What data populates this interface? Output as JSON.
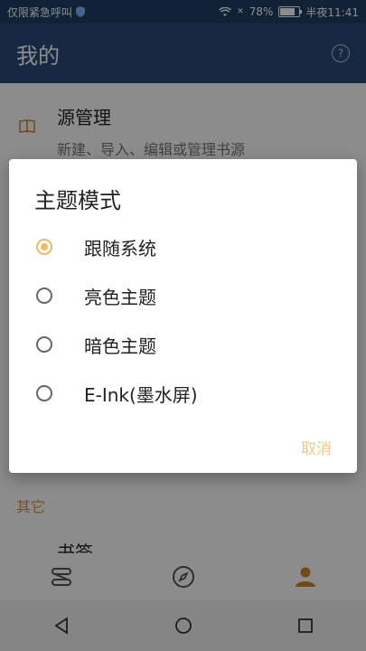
{
  "status_bar": {
    "carrier": "仅限紧急呼叫",
    "battery": "78%",
    "time": "半夜11:41"
  },
  "app_bar": {
    "title": "我的",
    "help_icon": "question-circle-icon"
  },
  "content": {
    "source_item": {
      "title": "源管理",
      "subtitle": "新建、导入、编辑或管理书源",
      "icon": "book-icon"
    },
    "section_other": "其它",
    "bookmark": "书签"
  },
  "dialog": {
    "title": "主题模式",
    "options": [
      {
        "label": "跟随系统",
        "selected": true
      },
      {
        "label": "亮色主题",
        "selected": false
      },
      {
        "label": "暗色主题",
        "selected": false
      },
      {
        "label": "E-Ink(墨水屏)",
        "selected": false
      }
    ],
    "cancel": "取消"
  },
  "bottom_nav": [
    "bookshelf-icon",
    "compass-icon",
    "person-icon"
  ],
  "colors": {
    "primary": "#2a4b79",
    "accent": "#f0b964"
  }
}
